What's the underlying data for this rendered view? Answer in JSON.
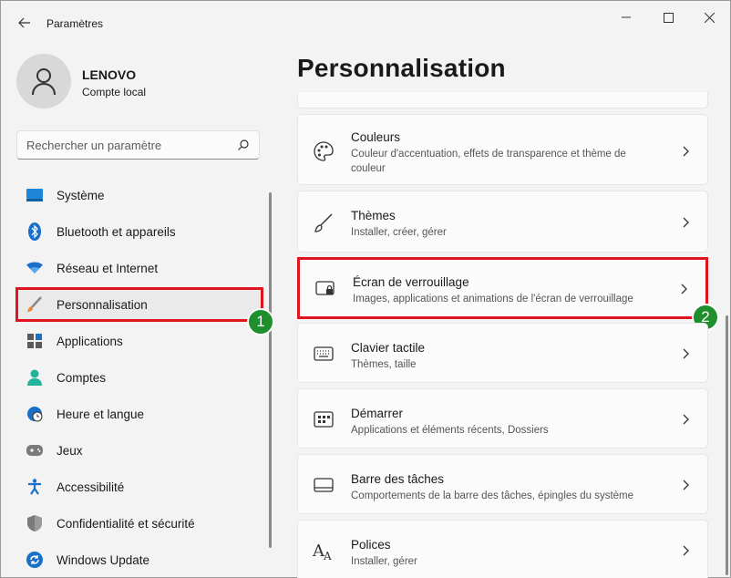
{
  "window": {
    "title": "Paramètres"
  },
  "profile": {
    "name": "LENOVO",
    "account_type": "Compte local"
  },
  "search": {
    "placeholder": "Rechercher un paramètre"
  },
  "sidebar": {
    "items": [
      {
        "label": "Système",
        "icon": "monitor-icon"
      },
      {
        "label": "Bluetooth et appareils",
        "icon": "bluetooth-icon"
      },
      {
        "label": "Réseau et Internet",
        "icon": "wifi-icon"
      },
      {
        "label": "Personnalisation",
        "icon": "brush-icon",
        "selected": true
      },
      {
        "label": "Applications",
        "icon": "apps-icon"
      },
      {
        "label": "Comptes",
        "icon": "person-icon"
      },
      {
        "label": "Heure et langue",
        "icon": "globe-clock-icon"
      },
      {
        "label": "Jeux",
        "icon": "gamepad-icon"
      },
      {
        "label": "Accessibilité",
        "icon": "accessibility-icon"
      },
      {
        "label": "Confidentialité et sécurité",
        "icon": "shield-icon"
      },
      {
        "label": "Windows Update",
        "icon": "update-icon"
      }
    ]
  },
  "annotations": {
    "badge_1": "1",
    "badge_2": "2"
  },
  "main": {
    "title": "Personnalisation",
    "cards": [
      {
        "title": "Couleurs",
        "subtitle": "Couleur d'accentuation, effets de transparence et thème de couleur",
        "icon": "palette-icon"
      },
      {
        "title": "Thèmes",
        "subtitle": "Installer, créer, gérer",
        "icon": "pen-brush-icon"
      },
      {
        "title": "Écran de verrouillage",
        "subtitle": "Images, applications et animations de l'écran de verrouillage",
        "icon": "lock-screen-icon"
      },
      {
        "title": "Clavier tactile",
        "subtitle": "Thèmes, taille",
        "icon": "keyboard-icon"
      },
      {
        "title": "Démarrer",
        "subtitle": "Applications et éléments récents, Dossiers",
        "icon": "start-menu-icon"
      },
      {
        "title": "Barre des tâches",
        "subtitle": "Comportements de la barre des tâches, épingles du système",
        "icon": "taskbar-icon"
      },
      {
        "title": "Polices",
        "subtitle": "Installer, gérer",
        "icon": "font-icon"
      }
    ]
  },
  "colors": {
    "accent_red": "#e0141e",
    "badge_green": "#1f8e2c"
  }
}
